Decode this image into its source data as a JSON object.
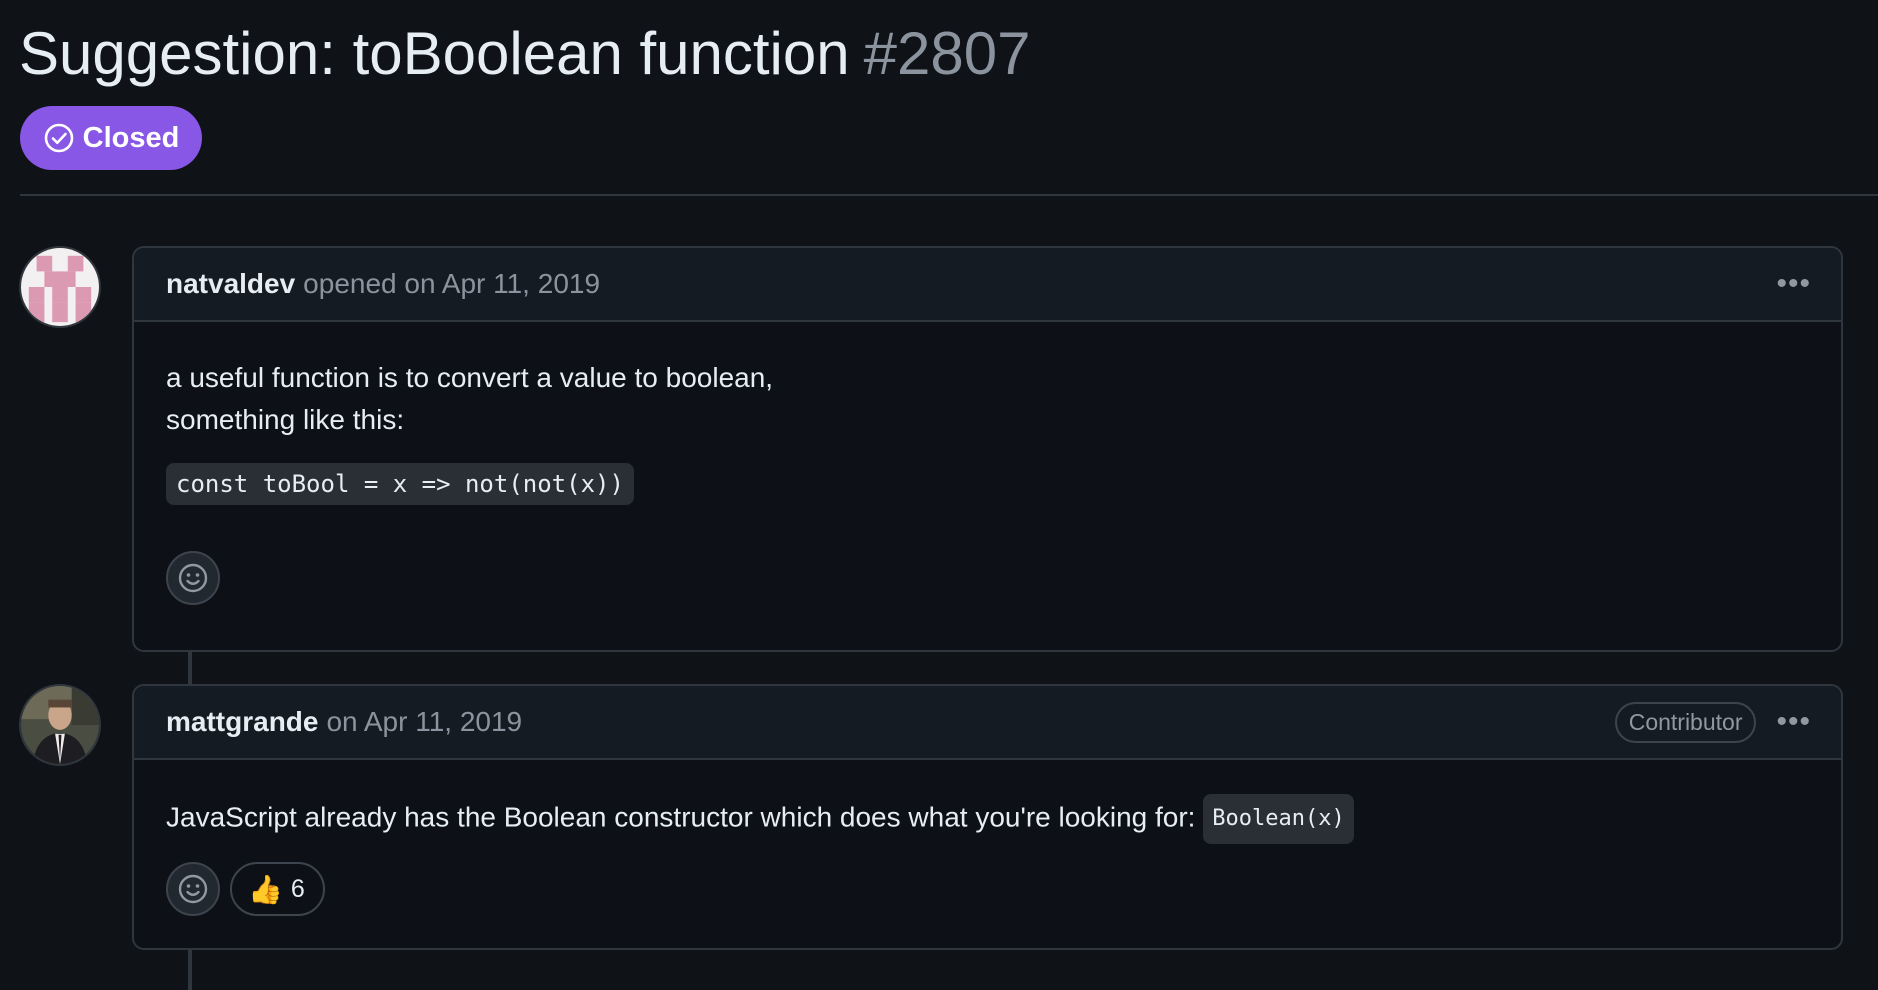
{
  "issue": {
    "title": "Suggestion: toBoolean function",
    "number": "#2807",
    "state": "Closed",
    "state_color": "#8957e5"
  },
  "comments": [
    {
      "author": "natvaldev",
      "meta": "opened on Apr 11, 2019",
      "body_lines": [
        "a useful function is to convert a value to boolean,",
        "something like this:"
      ],
      "code": "const toBool = x => not(not(x))"
    },
    {
      "author": "mattgrande",
      "meta": "on Apr 11, 2019",
      "role": "Contributor",
      "body": "JavaScript already has the Boolean constructor which does what you're looking for:",
      "inline_code": "Boolean(x)",
      "reactions": [
        {
          "emoji": "👍",
          "count": "6"
        }
      ]
    }
  ],
  "icons": {
    "state": "check-circle-icon",
    "add_reaction": "smiley-icon",
    "menu": "kebab-horizontal-icon"
  }
}
